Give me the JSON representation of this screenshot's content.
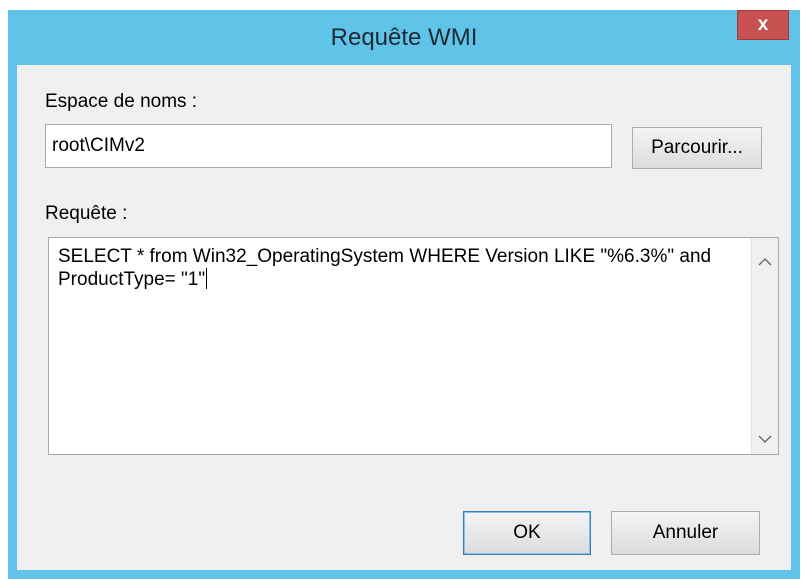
{
  "window": {
    "title": "Requête WMI",
    "close_label": "x"
  },
  "namespace": {
    "label": "Espace de noms :",
    "value": "root\\CIMv2",
    "browse_label": "Parcourir..."
  },
  "query": {
    "label": "Requête :",
    "text": "SELECT * from Win32_OperatingSystem WHERE Version LIKE \"%6.3%\" and ProductType= \"1\""
  },
  "buttons": {
    "ok_label": "OK",
    "cancel_label": "Annuler"
  },
  "icons": {
    "scroll_up": "chevron-up-icon",
    "scroll_down": "chevron-down-icon",
    "close": "close-icon"
  }
}
